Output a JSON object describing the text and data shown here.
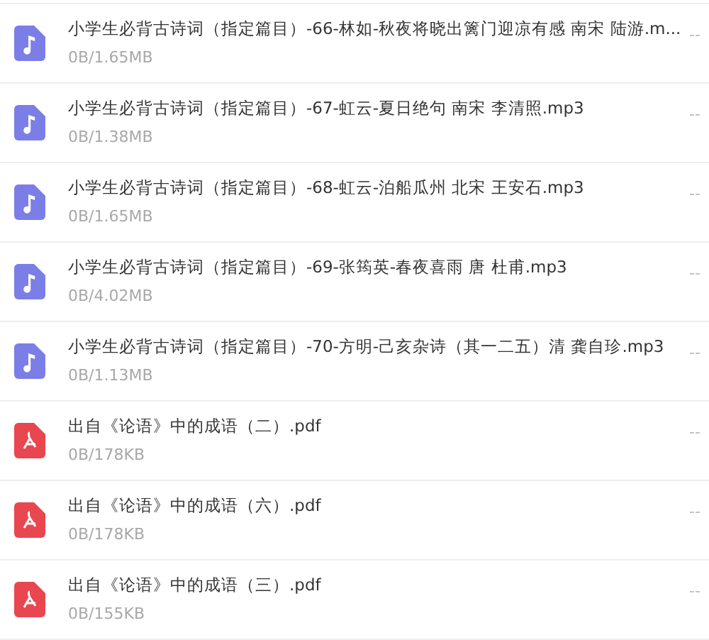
{
  "files": [
    {
      "kind": "audio",
      "name": "小学生必背古诗词（指定篇目）-66-林如-秋夜将晓出篱门迎凉有感 南宋 陆游.m...",
      "size": "0B/1.65MB",
      "status": "--"
    },
    {
      "kind": "audio",
      "name": "小学生必背古诗词（指定篇目）-67-虹云-夏日绝句 南宋 李清照.mp3",
      "size": "0B/1.38MB",
      "status": "--"
    },
    {
      "kind": "audio",
      "name": "小学生必背古诗词（指定篇目）-68-虹云-泊船瓜州 北宋 王安石.mp3",
      "size": "0B/1.65MB",
      "status": "--"
    },
    {
      "kind": "audio",
      "name": "小学生必背古诗词（指定篇目）-69-张筠英-春夜喜雨 唐 杜甫.mp3",
      "size": "0B/4.02MB",
      "status": "--"
    },
    {
      "kind": "audio",
      "name": "小学生必背古诗词（指定篇目）-70-方明-己亥杂诗（其一二五）清 龚自珍.mp3",
      "size": "0B/1.13MB",
      "status": "--"
    },
    {
      "kind": "pdf",
      "name": "出自《论语》中的成语（二）.pdf",
      "size": "0B/178KB",
      "status": "--"
    },
    {
      "kind": "pdf",
      "name": "出自《论语》中的成语（六）.pdf",
      "size": "0B/178KB",
      "status": "--"
    },
    {
      "kind": "pdf",
      "name": "出自《论语》中的成语（三）.pdf",
      "size": "0B/155KB",
      "status": "--"
    }
  ]
}
